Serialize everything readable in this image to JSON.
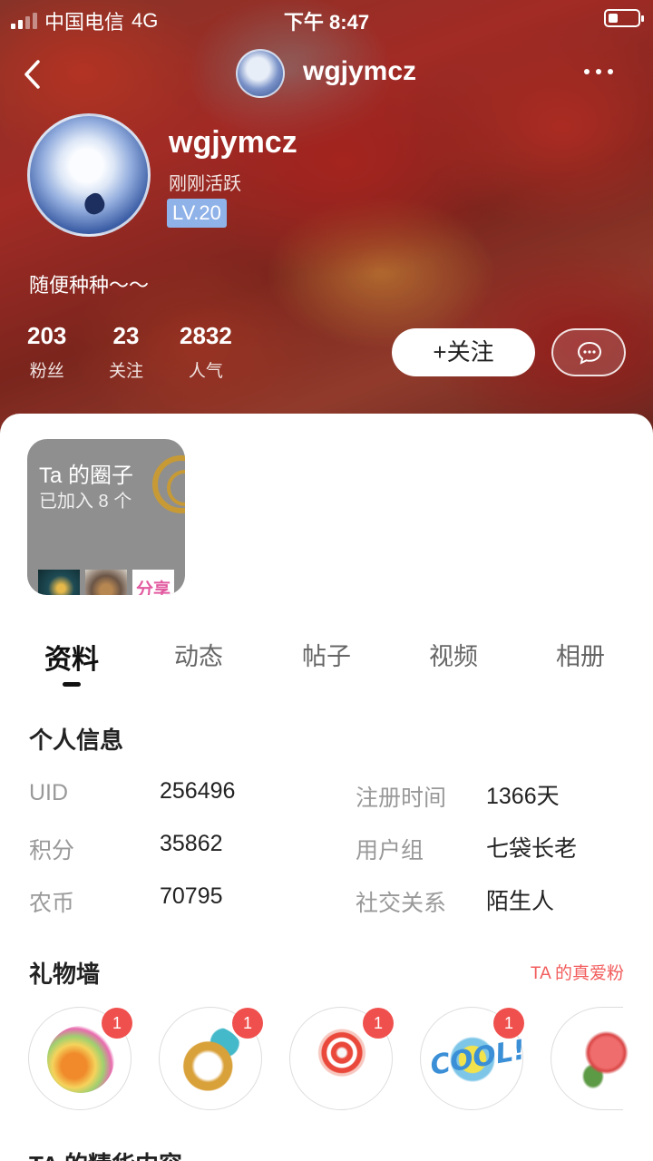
{
  "status_bar": {
    "carrier": "中国电信",
    "network": "4G",
    "time": "下午 8:47"
  },
  "nav": {
    "title": "wgjymcz"
  },
  "profile": {
    "name": "wgjymcz",
    "status": "刚刚活跃",
    "level": "LV.20",
    "signature": "随便种种～～",
    "stats": [
      {
        "value": "203",
        "label": "粉丝"
      },
      {
        "value": "23",
        "label": "关注"
      },
      {
        "value": "2832",
        "label": "人气"
      }
    ],
    "follow_label": "+关注"
  },
  "circle_card": {
    "title": "Ta 的圈子",
    "subtitle": "已加入 8 个",
    "thumb3_text": "分享"
  },
  "tabs": [
    {
      "label": "资料",
      "active": true
    },
    {
      "label": "动态",
      "active": false
    },
    {
      "label": "帖子",
      "active": false
    },
    {
      "label": "视频",
      "active": false
    },
    {
      "label": "相册",
      "active": false
    }
  ],
  "personal_info": {
    "title": "个人信息",
    "rows": [
      {
        "label": "UID",
        "value": "256496",
        "label2": "注册时间",
        "value2": "1366天"
      },
      {
        "label": "积分",
        "value": "35862",
        "label2": "用户组",
        "value2": "七袋长老"
      },
      {
        "label": "农币",
        "value": "70795",
        "label2": "社交关系",
        "value2": "陌生人"
      }
    ]
  },
  "gift_wall": {
    "title": "礼物墙",
    "link": "TA 的真爱粉",
    "gifts": [
      {
        "name": "party-popper",
        "count": "1"
      },
      {
        "name": "diamond-ring",
        "count": "1"
      },
      {
        "name": "lollipop",
        "count": "1"
      },
      {
        "name": "cool-sticker",
        "count": "1",
        "text": "COOL!"
      },
      {
        "name": "rose",
        "count": ""
      }
    ]
  },
  "featured": {
    "title": "TA 的精华内容"
  },
  "colors": {
    "accent_red": "#f0504d",
    "level_badge": "#8fb2e8",
    "link_red": "#f25c5c"
  }
}
